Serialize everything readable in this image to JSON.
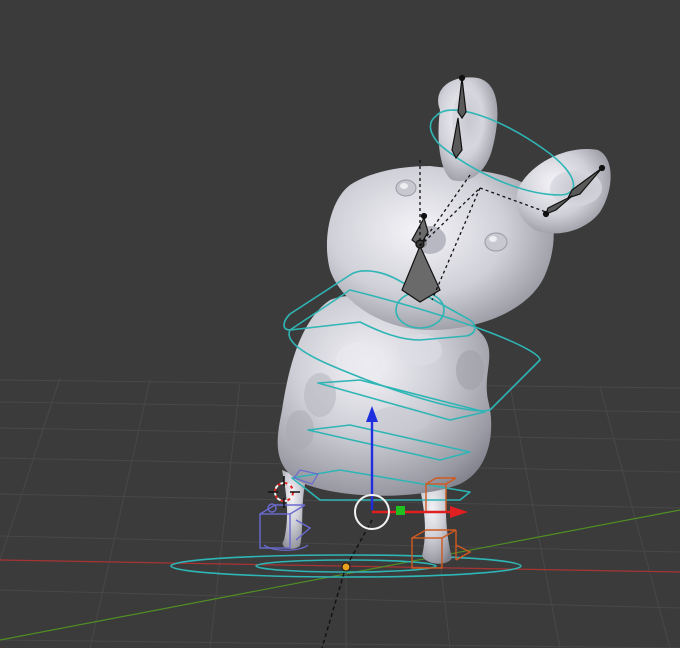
{
  "viewport": {
    "background": "#3b3b3b",
    "grid_color": "#4a4a4a",
    "x_axis_color": "#b03a3a",
    "y_axis_color": "#5a9a2a"
  },
  "scene": {
    "mesh": "rabbit-sculpt",
    "mesh_color": "#d4d4dc",
    "rig_color": "#2fb5b5",
    "bone_color": "#3a3a3a",
    "gizmo": {
      "x_axis_color": "#e02020",
      "y_axis_color": "#20c020",
      "z_axis_color": "#2020e0"
    },
    "foot_control_left_color": "#6a6ad0",
    "foot_control_right_color": "#d05a20",
    "cursor_icon": "3d-cursor-icon",
    "origin_icon": "origin-dot-icon"
  }
}
